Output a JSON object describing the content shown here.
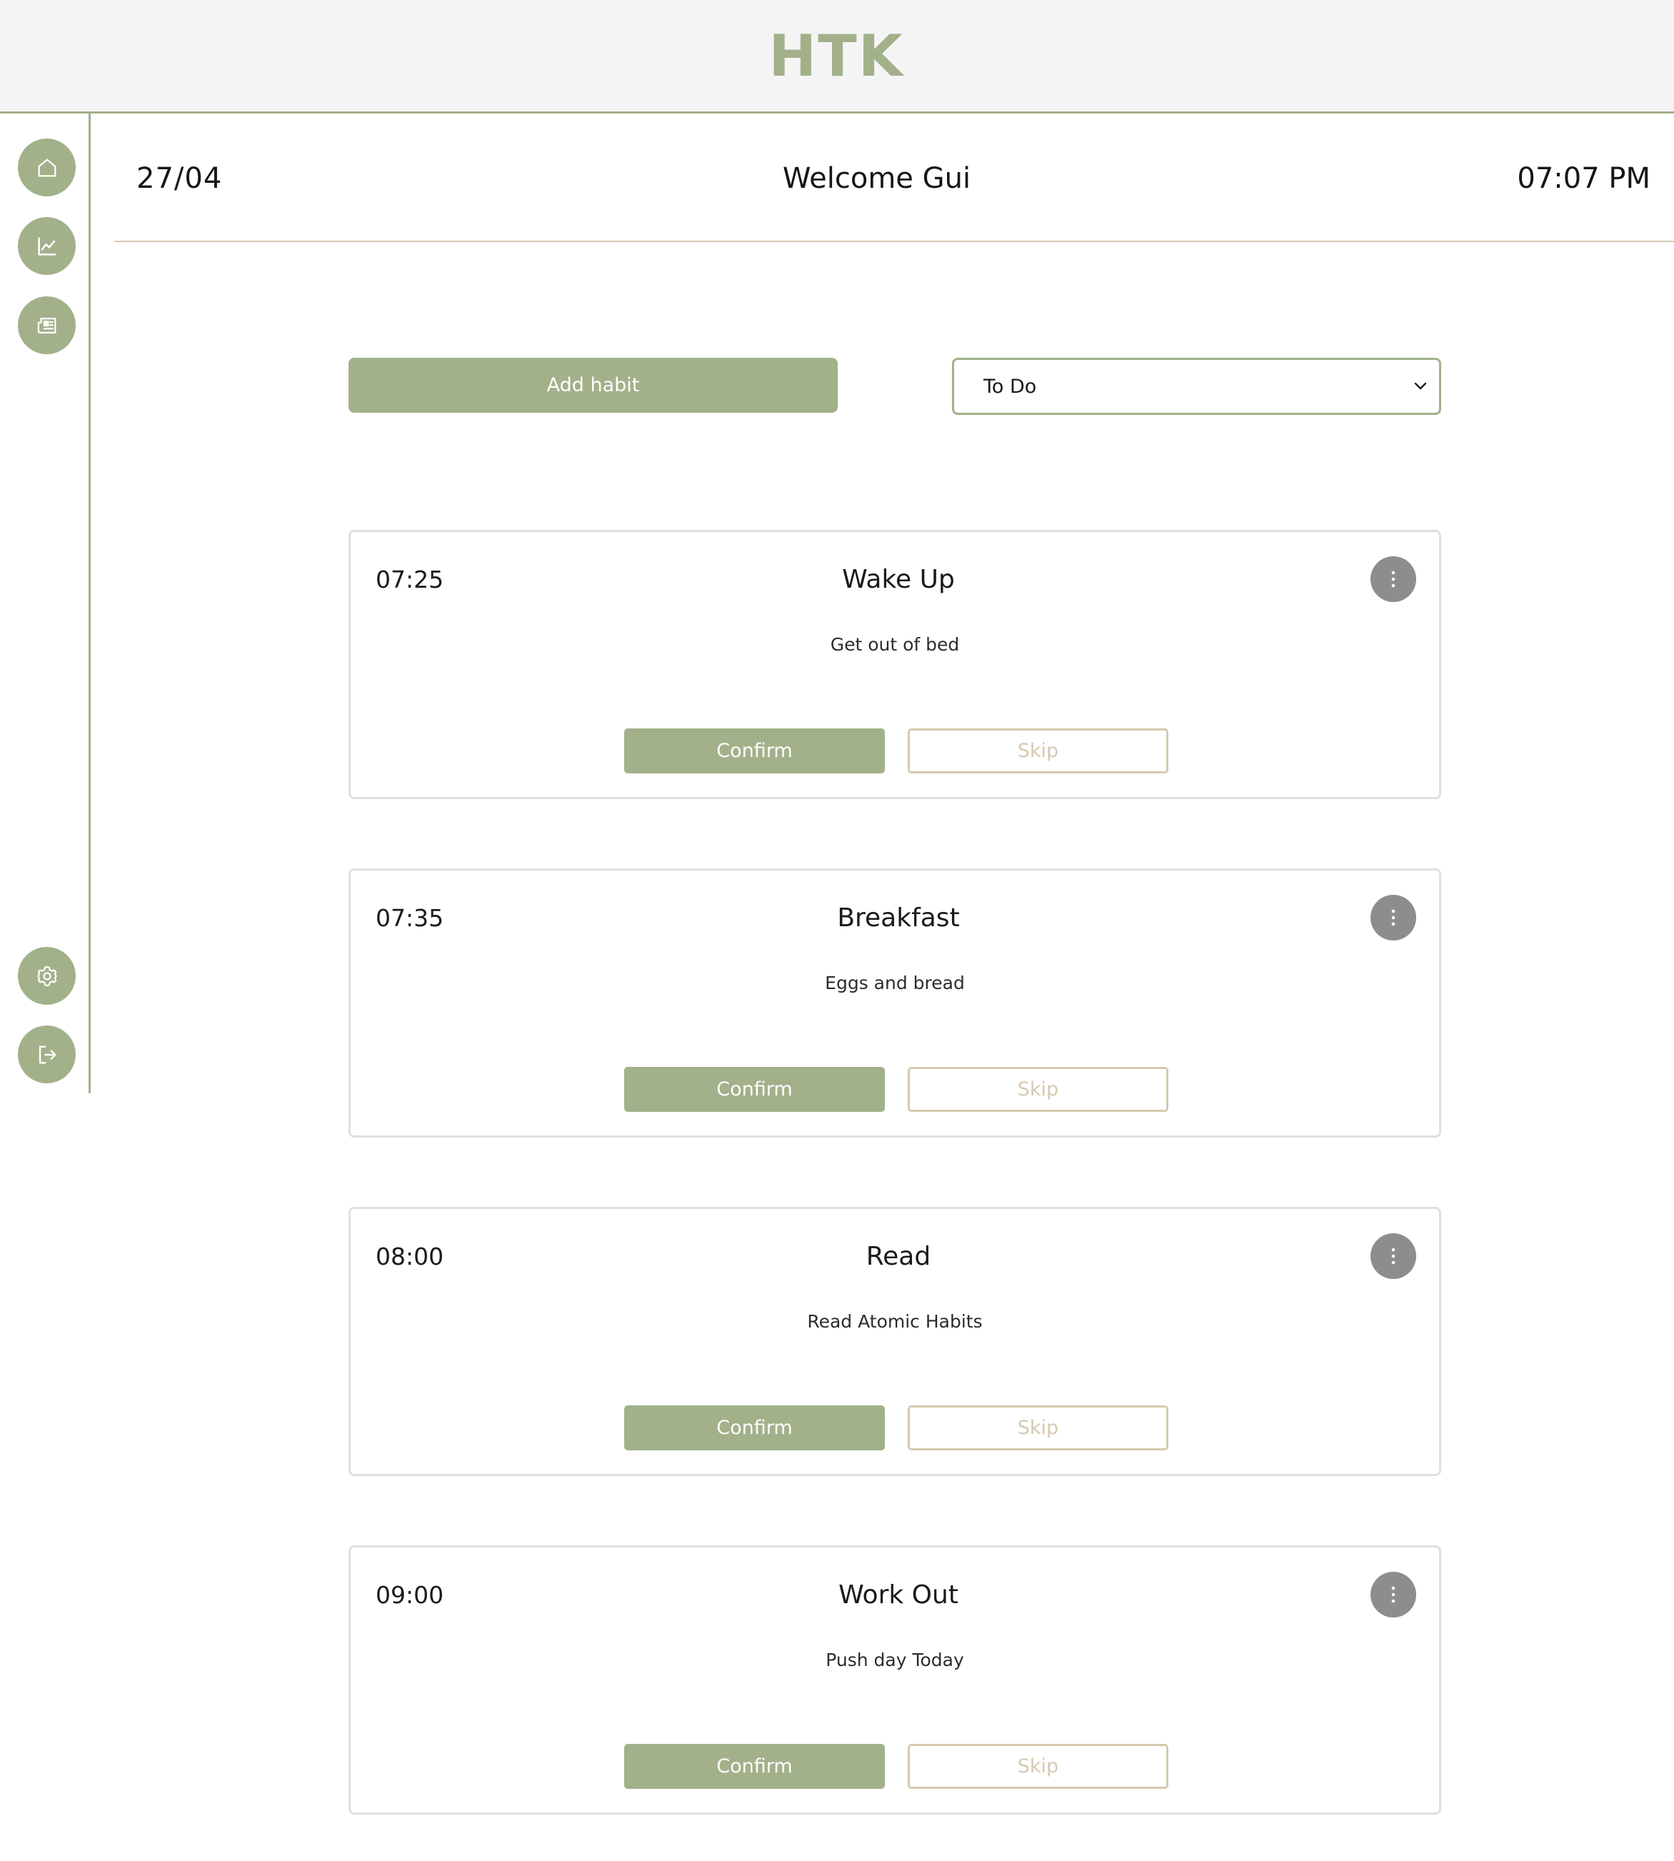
{
  "header": {
    "brand": "HTK"
  },
  "sidebar": {
    "top_items": [
      {
        "icon": "home-icon"
      },
      {
        "icon": "chart-icon"
      },
      {
        "icon": "newspaper-icon"
      }
    ],
    "bottom_items": [
      {
        "icon": "gear-icon"
      },
      {
        "icon": "logout-icon"
      }
    ]
  },
  "greeting": {
    "date": "27/04",
    "title": "Welcome Gui",
    "time": "07:07 PM"
  },
  "toolbar": {
    "add_label": "Add habit",
    "filter_value": "To Do"
  },
  "habits": [
    {
      "time": "07:25",
      "name": "Wake Up",
      "description": "Get out of bed",
      "confirm_label": "Confirm",
      "skip_label": "Skip"
    },
    {
      "time": "07:35",
      "name": "Breakfast",
      "description": "Eggs and bread",
      "confirm_label": "Confirm",
      "skip_label": "Skip"
    },
    {
      "time": "08:00",
      "name": "Read",
      "description": "Read Atomic Habits",
      "confirm_label": "Confirm",
      "skip_label": "Skip"
    },
    {
      "time": "09:00",
      "name": "Work Out",
      "description": "Push day Today",
      "confirm_label": "Confirm",
      "skip_label": "Skip"
    }
  ],
  "colors": {
    "accent": "#a2b18a",
    "secondary": "#d6c9b0",
    "menu_button": "#8d8d8d",
    "header_bg": "#f4f4f4"
  }
}
